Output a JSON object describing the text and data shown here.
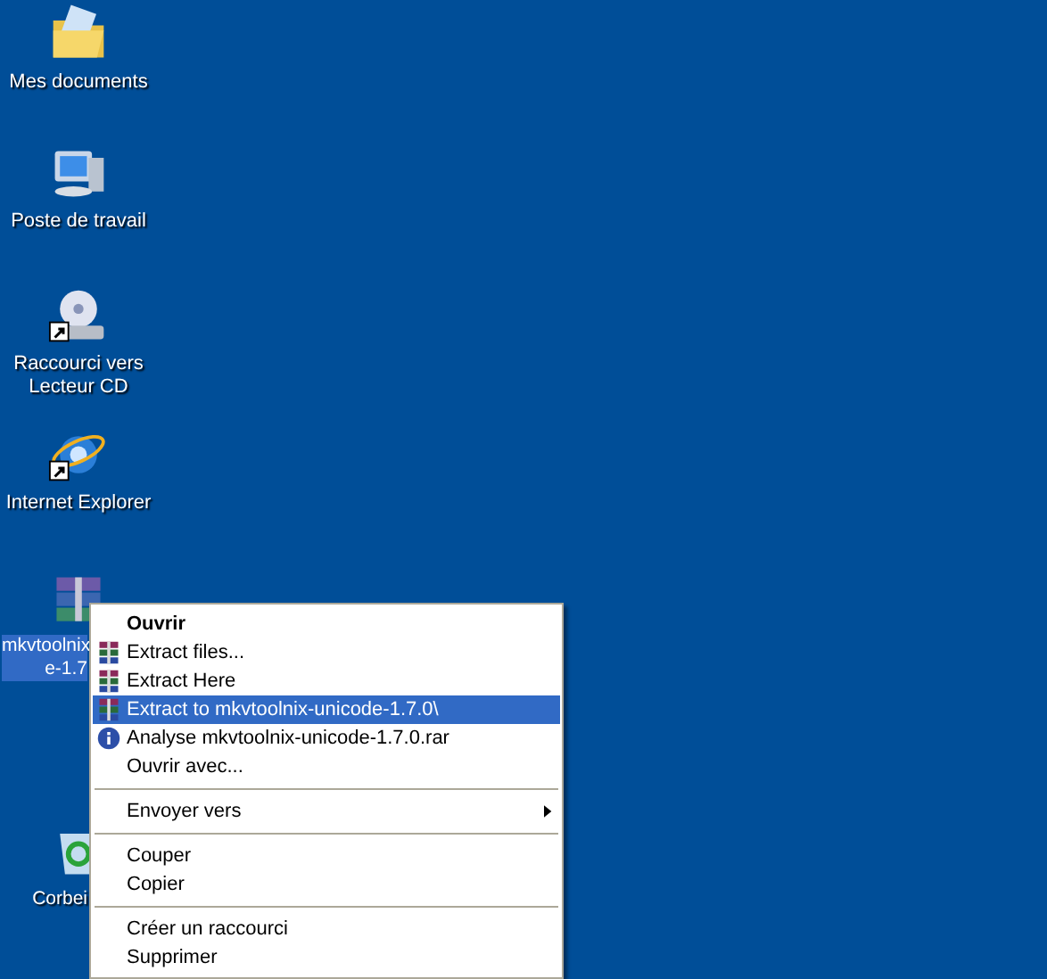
{
  "desktop_icons": [
    {
      "kind": "folder",
      "label": [
        "Mes documents"
      ],
      "shortcut": false,
      "selected": false
    },
    {
      "kind": "computer",
      "label": [
        "Poste de travail"
      ],
      "shortcut": false,
      "selected": false
    },
    {
      "kind": "cd",
      "label": [
        "Raccourci vers",
        "Lecteur CD"
      ],
      "shortcut": true,
      "selected": false
    },
    {
      "kind": "browser",
      "label": [
        "Internet Explorer"
      ],
      "shortcut": true,
      "selected": false
    },
    {
      "kind": "archive",
      "label": [
        "mkvtoolnix",
        "e-1.7"
      ],
      "shortcut": false,
      "selected": true
    },
    {
      "kind": "recycle",
      "label": [
        "Corbei"
      ],
      "shortcut": false,
      "selected": false
    }
  ],
  "context_menu": [
    {
      "kind": "default",
      "label": "Ouvrir",
      "selected": false
    },
    {
      "kind": "archive",
      "label": "Extract files...",
      "selected": false
    },
    {
      "kind": "archive",
      "label": "Extract Here",
      "selected": false
    },
    {
      "kind": "archive",
      "label": "Extract to mkvtoolnix-unicode-1.7.0\\",
      "selected": true
    },
    {
      "kind": "info",
      "label": "Analyse mkvtoolnix-unicode-1.7.0.rar",
      "selected": false
    },
    {
      "kind": "plain",
      "label": "Ouvrir avec...",
      "selected": false
    },
    {
      "kind": "separator"
    },
    {
      "kind": "submenu",
      "label": "Envoyer vers",
      "selected": false
    },
    {
      "kind": "separator"
    },
    {
      "kind": "plain",
      "label": "Couper",
      "selected": false
    },
    {
      "kind": "plain",
      "label": "Copier",
      "selected": false
    },
    {
      "kind": "separator"
    },
    {
      "kind": "plain",
      "label": "Créer un raccourci",
      "selected": false
    },
    {
      "kind": "plain",
      "label": "Supprimer",
      "selected": false
    }
  ]
}
